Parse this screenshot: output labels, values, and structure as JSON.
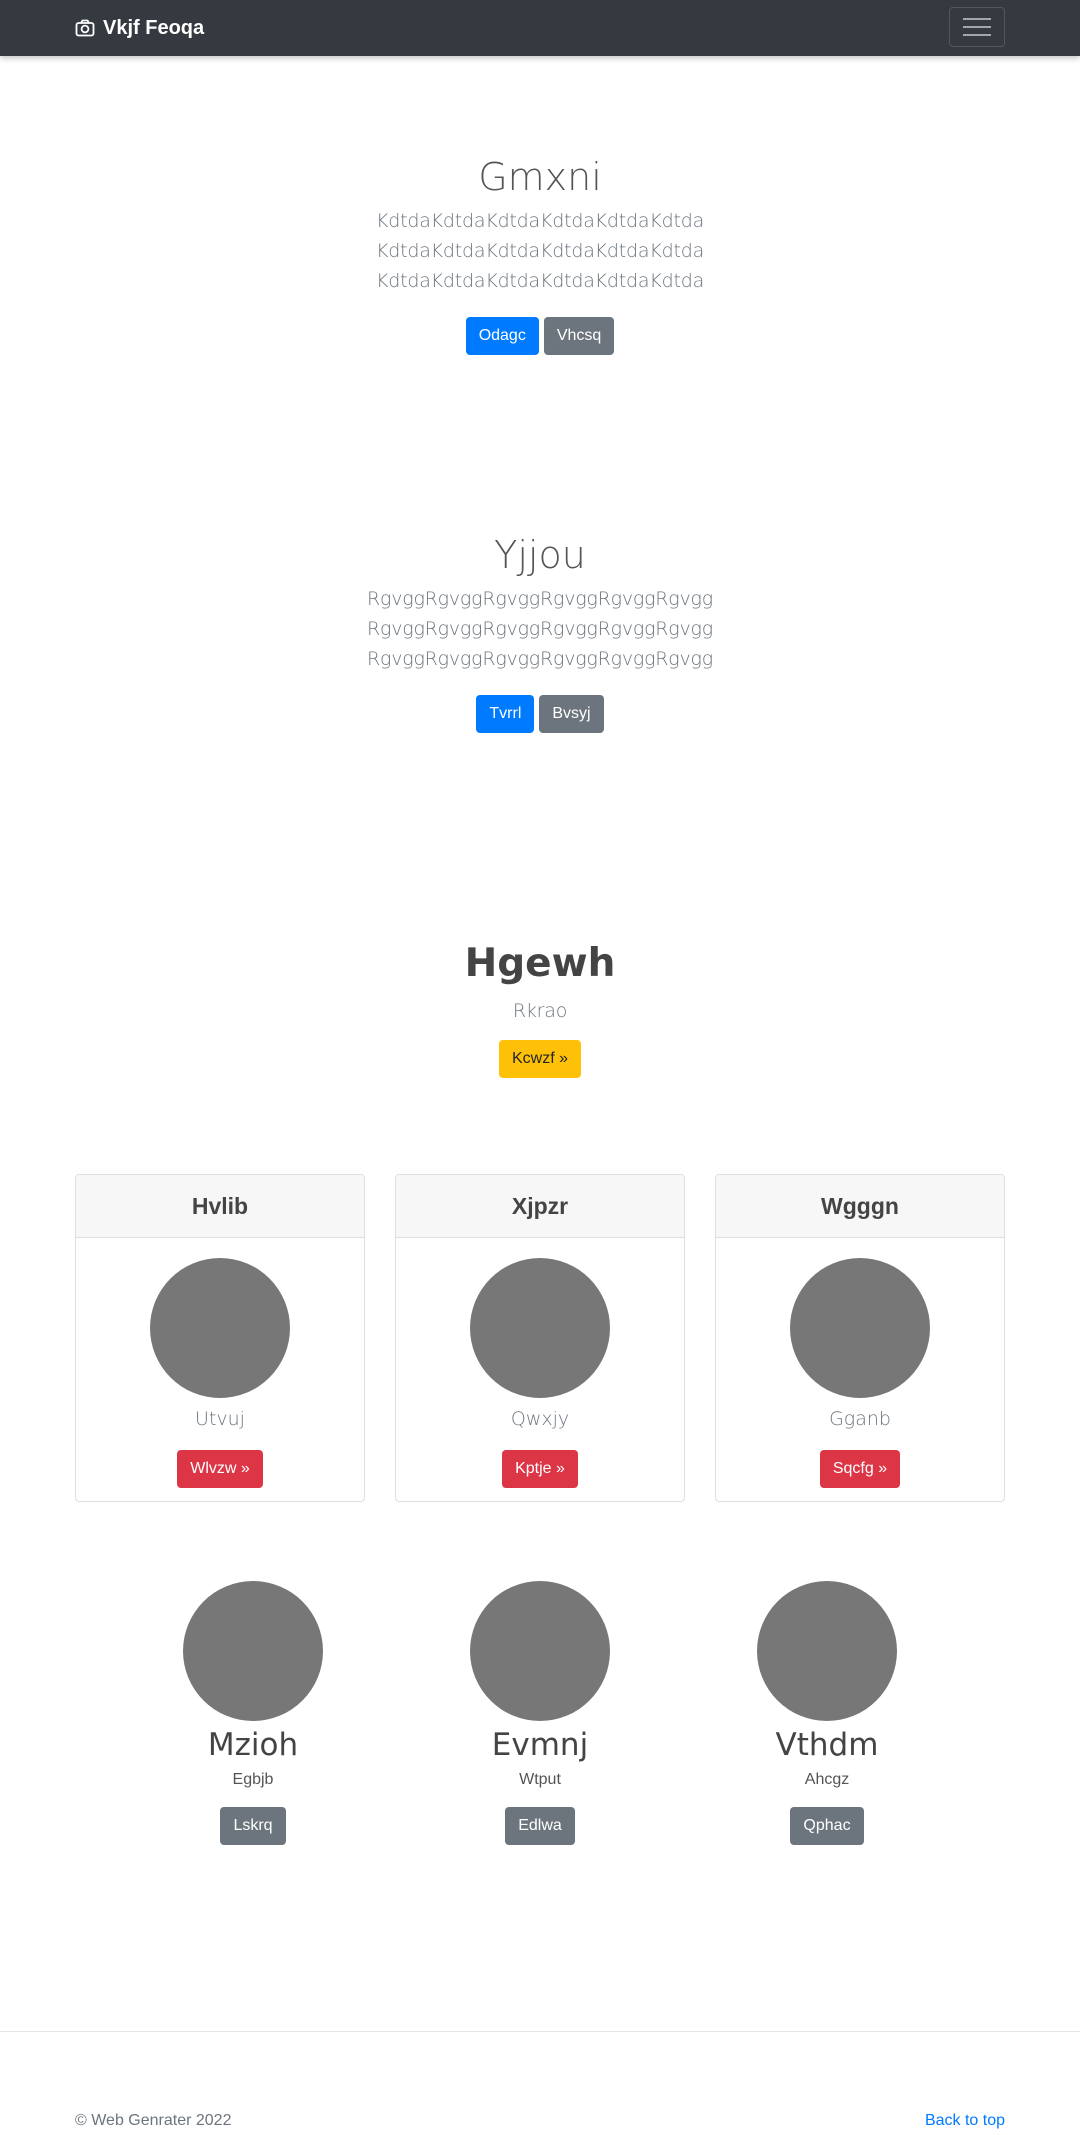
{
  "navbar": {
    "brand": "Vkjf Feoqa",
    "brand_icon": "camera-icon",
    "toggler_icon": "hamburger-menu-icon"
  },
  "hero1": {
    "title": "Gmxni",
    "lead_line1": "KdtdaKdtdaKdtdaKdtdaKdtdaKdtda KdtdaKdtdaKdtdaKdtdaKdtdaKdtda",
    "lead_line2": "KdtdaKdtdaKdtdaKdtdaKdtdaKdtda",
    "primary_button": "Odagc",
    "secondary_button": "Vhcsq"
  },
  "hero2": {
    "title": "Yjjou",
    "lead_lines": [
      "RgvggRgvggRgvggRgvggRgvggRgvgg",
      "RgvggRgvggRgvggRgvggRgvggRgvgg",
      "RgvggRgvggRgvggRgvggRgvggRgvgg"
    ],
    "primary_button": "Tvrrl",
    "secondary_button": "Bvsyj"
  },
  "feature": {
    "title": "Hgewh",
    "subtitle": "Rkrao",
    "button": "Kcwzf »"
  },
  "cards": [
    {
      "header": "Hvlib",
      "text": "Utvuj",
      "button": "Wlvzw »"
    },
    {
      "header": "Xjpzr",
      "text": "Qwxjy",
      "button": "Kptje »"
    },
    {
      "header": "Wgggn",
      "text": "Gganb",
      "button": "Sqcfg »"
    }
  ],
  "people": [
    {
      "name": "Mzioh",
      "sub": "Egbjb",
      "button": "Lskrq"
    },
    {
      "name": "Evmnj",
      "sub": "Wtput",
      "button": "Edlwa"
    },
    {
      "name": "Vthdm",
      "sub": "Ahcgz",
      "button": "Qphac"
    }
  ],
  "footer": {
    "copyright": "© Web Genrater 2022",
    "back_to_top": "Back to top"
  },
  "colors": {
    "navbar": "#343a40",
    "primary": "#007bff",
    "secondary": "#6c757d",
    "warning": "#ffc107",
    "danger": "#dc3545",
    "placeholder_circle": "#777777"
  }
}
